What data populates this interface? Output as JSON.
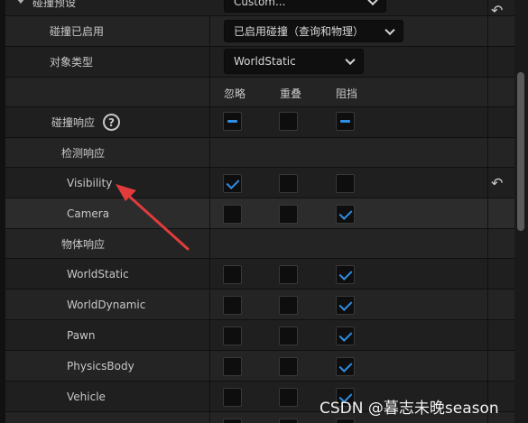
{
  "category": {
    "label": "碰撞预设",
    "value": "Custom..."
  },
  "collision_enabled": {
    "label": "碰撞已启用",
    "value": "已启用碰撞（查询和物理）"
  },
  "object_type": {
    "label": "对象类型",
    "value": "WorldStatic"
  },
  "column_headers": {
    "ignore": "忽略",
    "overlap": "重叠",
    "block": "阻挡"
  },
  "collision_response": {
    "label": "碰撞响应",
    "help": "?",
    "states": [
      "mixed",
      "off",
      "mixed"
    ]
  },
  "trace_section": {
    "label": "检测响应"
  },
  "trace_responses": [
    {
      "label": "Visibility",
      "states": [
        "on",
        "off",
        "off"
      ],
      "reset": true
    },
    {
      "label": "Camera",
      "states": [
        "off",
        "off",
        "on"
      ],
      "reset": false
    }
  ],
  "object_section": {
    "label": "物体响应"
  },
  "object_responses": [
    {
      "label": "WorldStatic",
      "states": [
        "off",
        "off",
        "on"
      ]
    },
    {
      "label": "WorldDynamic",
      "states": [
        "off",
        "off",
        "on"
      ]
    },
    {
      "label": "Pawn",
      "states": [
        "off",
        "off",
        "on"
      ]
    },
    {
      "label": "PhysicsBody",
      "states": [
        "off",
        "off",
        "on"
      ]
    },
    {
      "label": "Vehicle",
      "states": [
        "off",
        "off",
        "on"
      ]
    },
    {
      "label": "",
      "states": [
        "off",
        "off",
        "on"
      ]
    }
  ],
  "icons": {
    "reset": "reset-arrow-icon",
    "help": "help-icon",
    "dropdown": "chevron-down-icon",
    "annotation": "red-arrow"
  },
  "colors": {
    "accent": "#2f8fe6",
    "annotation": "#e23b3b"
  },
  "watermark": "CSDN @暮志未晚season"
}
